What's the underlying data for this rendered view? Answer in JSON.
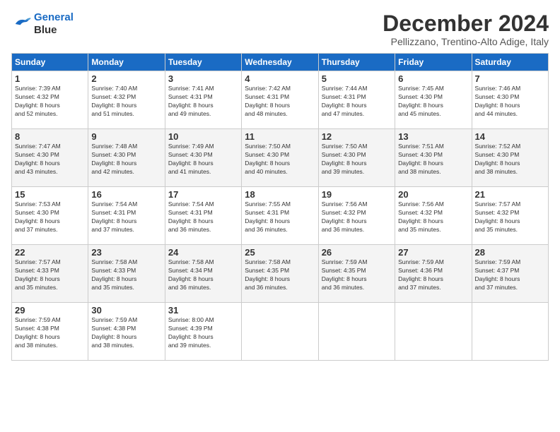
{
  "header": {
    "logo_line1": "General",
    "logo_line2": "Blue",
    "month": "December 2024",
    "location": "Pellizzano, Trentino-Alto Adige, Italy"
  },
  "days_of_week": [
    "Sunday",
    "Monday",
    "Tuesday",
    "Wednesday",
    "Thursday",
    "Friday",
    "Saturday"
  ],
  "weeks": [
    [
      {
        "day": "1",
        "info": "Sunrise: 7:39 AM\nSunset: 4:32 PM\nDaylight: 8 hours\nand 52 minutes."
      },
      {
        "day": "2",
        "info": "Sunrise: 7:40 AM\nSunset: 4:32 PM\nDaylight: 8 hours\nand 51 minutes."
      },
      {
        "day": "3",
        "info": "Sunrise: 7:41 AM\nSunset: 4:31 PM\nDaylight: 8 hours\nand 49 minutes."
      },
      {
        "day": "4",
        "info": "Sunrise: 7:42 AM\nSunset: 4:31 PM\nDaylight: 8 hours\nand 48 minutes."
      },
      {
        "day": "5",
        "info": "Sunrise: 7:44 AM\nSunset: 4:31 PM\nDaylight: 8 hours\nand 47 minutes."
      },
      {
        "day": "6",
        "info": "Sunrise: 7:45 AM\nSunset: 4:30 PM\nDaylight: 8 hours\nand 45 minutes."
      },
      {
        "day": "7",
        "info": "Sunrise: 7:46 AM\nSunset: 4:30 PM\nDaylight: 8 hours\nand 44 minutes."
      }
    ],
    [
      {
        "day": "8",
        "info": "Sunrise: 7:47 AM\nSunset: 4:30 PM\nDaylight: 8 hours\nand 43 minutes."
      },
      {
        "day": "9",
        "info": "Sunrise: 7:48 AM\nSunset: 4:30 PM\nDaylight: 8 hours\nand 42 minutes."
      },
      {
        "day": "10",
        "info": "Sunrise: 7:49 AM\nSunset: 4:30 PM\nDaylight: 8 hours\nand 41 minutes."
      },
      {
        "day": "11",
        "info": "Sunrise: 7:50 AM\nSunset: 4:30 PM\nDaylight: 8 hours\nand 40 minutes."
      },
      {
        "day": "12",
        "info": "Sunrise: 7:50 AM\nSunset: 4:30 PM\nDaylight: 8 hours\nand 39 minutes."
      },
      {
        "day": "13",
        "info": "Sunrise: 7:51 AM\nSunset: 4:30 PM\nDaylight: 8 hours\nand 38 minutes."
      },
      {
        "day": "14",
        "info": "Sunrise: 7:52 AM\nSunset: 4:30 PM\nDaylight: 8 hours\nand 38 minutes."
      }
    ],
    [
      {
        "day": "15",
        "info": "Sunrise: 7:53 AM\nSunset: 4:30 PM\nDaylight: 8 hours\nand 37 minutes."
      },
      {
        "day": "16",
        "info": "Sunrise: 7:54 AM\nSunset: 4:31 PM\nDaylight: 8 hours\nand 37 minutes."
      },
      {
        "day": "17",
        "info": "Sunrise: 7:54 AM\nSunset: 4:31 PM\nDaylight: 8 hours\nand 36 minutes."
      },
      {
        "day": "18",
        "info": "Sunrise: 7:55 AM\nSunset: 4:31 PM\nDaylight: 8 hours\nand 36 minutes."
      },
      {
        "day": "19",
        "info": "Sunrise: 7:56 AM\nSunset: 4:32 PM\nDaylight: 8 hours\nand 36 minutes."
      },
      {
        "day": "20",
        "info": "Sunrise: 7:56 AM\nSunset: 4:32 PM\nDaylight: 8 hours\nand 35 minutes."
      },
      {
        "day": "21",
        "info": "Sunrise: 7:57 AM\nSunset: 4:32 PM\nDaylight: 8 hours\nand 35 minutes."
      }
    ],
    [
      {
        "day": "22",
        "info": "Sunrise: 7:57 AM\nSunset: 4:33 PM\nDaylight: 8 hours\nand 35 minutes."
      },
      {
        "day": "23",
        "info": "Sunrise: 7:58 AM\nSunset: 4:33 PM\nDaylight: 8 hours\nand 35 minutes."
      },
      {
        "day": "24",
        "info": "Sunrise: 7:58 AM\nSunset: 4:34 PM\nDaylight: 8 hours\nand 36 minutes."
      },
      {
        "day": "25",
        "info": "Sunrise: 7:58 AM\nSunset: 4:35 PM\nDaylight: 8 hours\nand 36 minutes."
      },
      {
        "day": "26",
        "info": "Sunrise: 7:59 AM\nSunset: 4:35 PM\nDaylight: 8 hours\nand 36 minutes."
      },
      {
        "day": "27",
        "info": "Sunrise: 7:59 AM\nSunset: 4:36 PM\nDaylight: 8 hours\nand 37 minutes."
      },
      {
        "day": "28",
        "info": "Sunrise: 7:59 AM\nSunset: 4:37 PM\nDaylight: 8 hours\nand 37 minutes."
      }
    ],
    [
      {
        "day": "29",
        "info": "Sunrise: 7:59 AM\nSunset: 4:38 PM\nDaylight: 8 hours\nand 38 minutes."
      },
      {
        "day": "30",
        "info": "Sunrise: 7:59 AM\nSunset: 4:38 PM\nDaylight: 8 hours\nand 38 minutes."
      },
      {
        "day": "31",
        "info": "Sunrise: 8:00 AM\nSunset: 4:39 PM\nDaylight: 8 hours\nand 39 minutes."
      },
      null,
      null,
      null,
      null
    ]
  ]
}
